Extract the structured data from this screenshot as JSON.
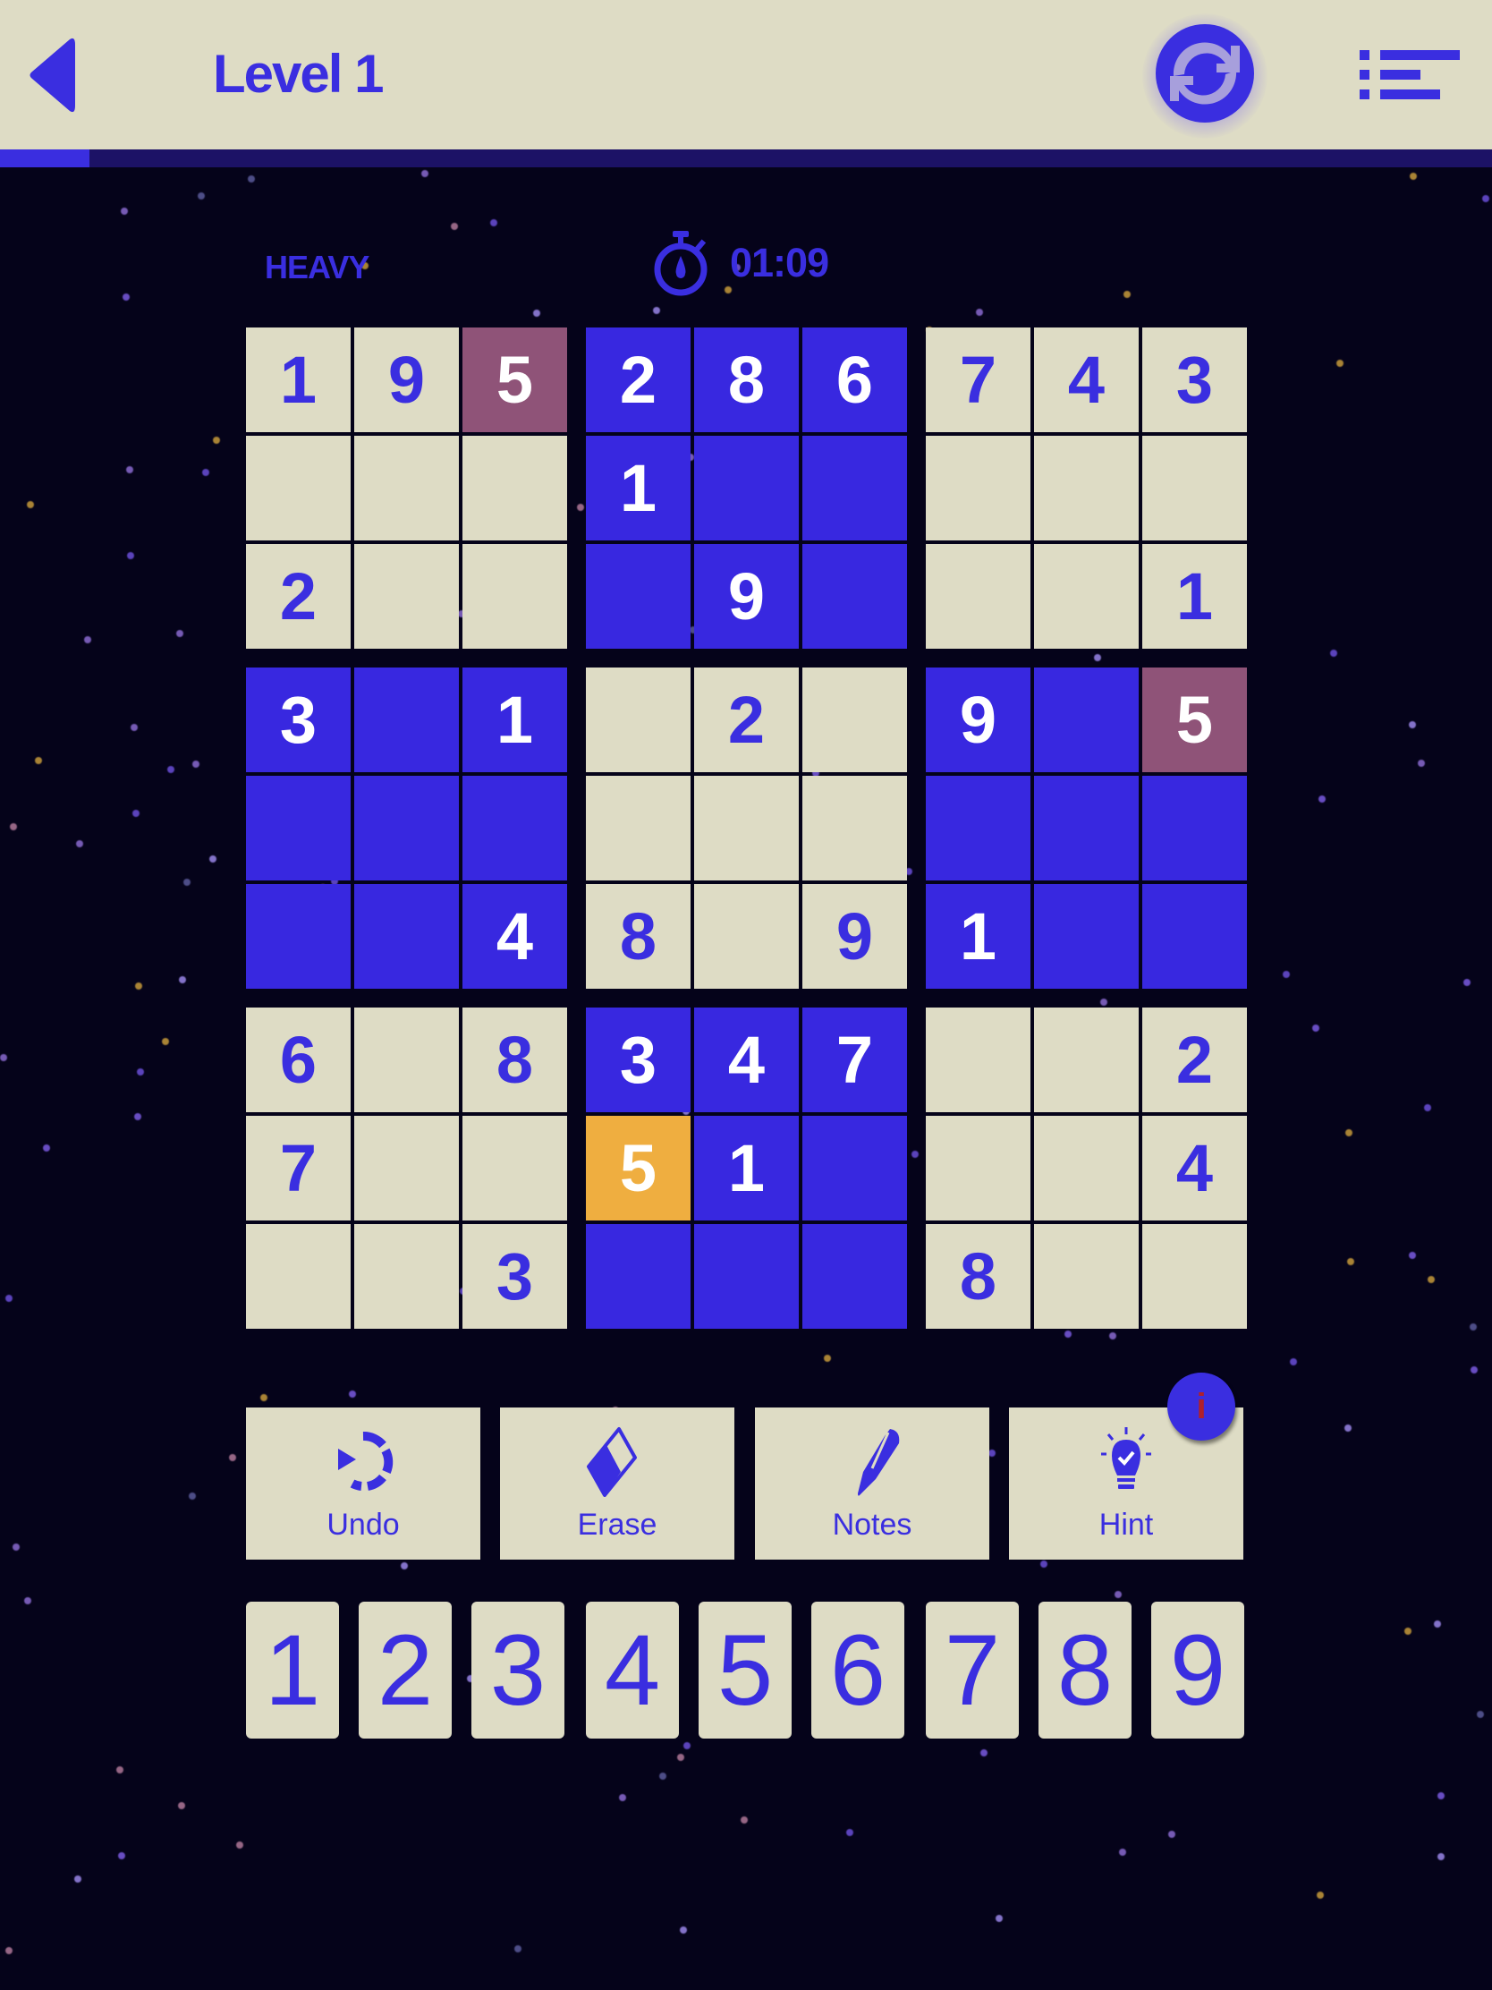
{
  "header": {
    "title": "Level 1",
    "back_icon": "back-arrow-icon",
    "refresh_icon": "refresh-icon",
    "menu_icon": "list-menu-icon"
  },
  "progress": {
    "fraction": 0.06
  },
  "status": {
    "difficulty": "HEAVY",
    "timer_icon": "stopwatch-icon",
    "timer": "01:09"
  },
  "colors": {
    "accent": "#3a2ee0",
    "cream": "#dedcc5",
    "highlight_blue": "#3828e0",
    "conflict": "#8f5378",
    "selected": "#efae40",
    "background": "#05031a"
  },
  "board": {
    "rows": [
      [
        "1",
        "9",
        "5",
        "2",
        "8",
        "6",
        "7",
        "4",
        "3"
      ],
      [
        "",
        "",
        "",
        "1",
        "",
        "",
        "",
        "",
        ""
      ],
      [
        "2",
        "",
        "",
        "",
        "9",
        "",
        "",
        "",
        "1"
      ],
      [
        "3",
        "",
        "1",
        "",
        "2",
        "",
        "9",
        "",
        "5"
      ],
      [
        "",
        "",
        "",
        "",
        "",
        "",
        "",
        "",
        ""
      ],
      [
        "",
        "",
        "4",
        "8",
        "",
        "9",
        "1",
        "",
        ""
      ],
      [
        "6",
        "",
        "8",
        "3",
        "4",
        "7",
        "",
        "",
        "2"
      ],
      [
        "7",
        "",
        "",
        "5",
        "1",
        "",
        "",
        "",
        "4"
      ],
      [
        "",
        "",
        "3",
        "",
        "",
        "",
        "8",
        "",
        ""
      ]
    ],
    "cell_states": [
      [
        "cream",
        "cream",
        "mauve",
        "blue",
        "blue",
        "blue",
        "cream",
        "cream",
        "cream"
      ],
      [
        "cream",
        "cream",
        "cream",
        "blue",
        "blue",
        "blue",
        "cream",
        "cream",
        "cream"
      ],
      [
        "cream",
        "cream",
        "cream",
        "blue",
        "blue",
        "blue",
        "cream",
        "cream",
        "cream"
      ],
      [
        "blue",
        "blue",
        "blue",
        "cream",
        "cream",
        "cream",
        "blue",
        "blue",
        "mauve"
      ],
      [
        "blue",
        "blue",
        "blue",
        "cream",
        "cream",
        "cream",
        "blue",
        "blue",
        "blue"
      ],
      [
        "blue",
        "blue",
        "blue",
        "cream",
        "cream",
        "cream",
        "blue",
        "blue",
        "blue"
      ],
      [
        "cream",
        "cream",
        "cream",
        "blue",
        "blue",
        "blue",
        "cream",
        "cream",
        "cream"
      ],
      [
        "cream",
        "cream",
        "cream",
        "orange",
        "blue",
        "blue",
        "cream",
        "cream",
        "cream"
      ],
      [
        "cream",
        "cream",
        "cream",
        "blue",
        "blue",
        "blue",
        "cream",
        "cream",
        "cream"
      ]
    ]
  },
  "tools": [
    {
      "label": "Undo",
      "icon": "undo-icon"
    },
    {
      "label": "Erase",
      "icon": "eraser-icon"
    },
    {
      "label": "Notes",
      "icon": "pen-icon"
    },
    {
      "label": "Hint",
      "icon": "lightbulb-check-icon"
    }
  ],
  "hint_badge": "i",
  "number_pad": [
    "1",
    "2",
    "3",
    "4",
    "5",
    "6",
    "7",
    "8",
    "9"
  ]
}
